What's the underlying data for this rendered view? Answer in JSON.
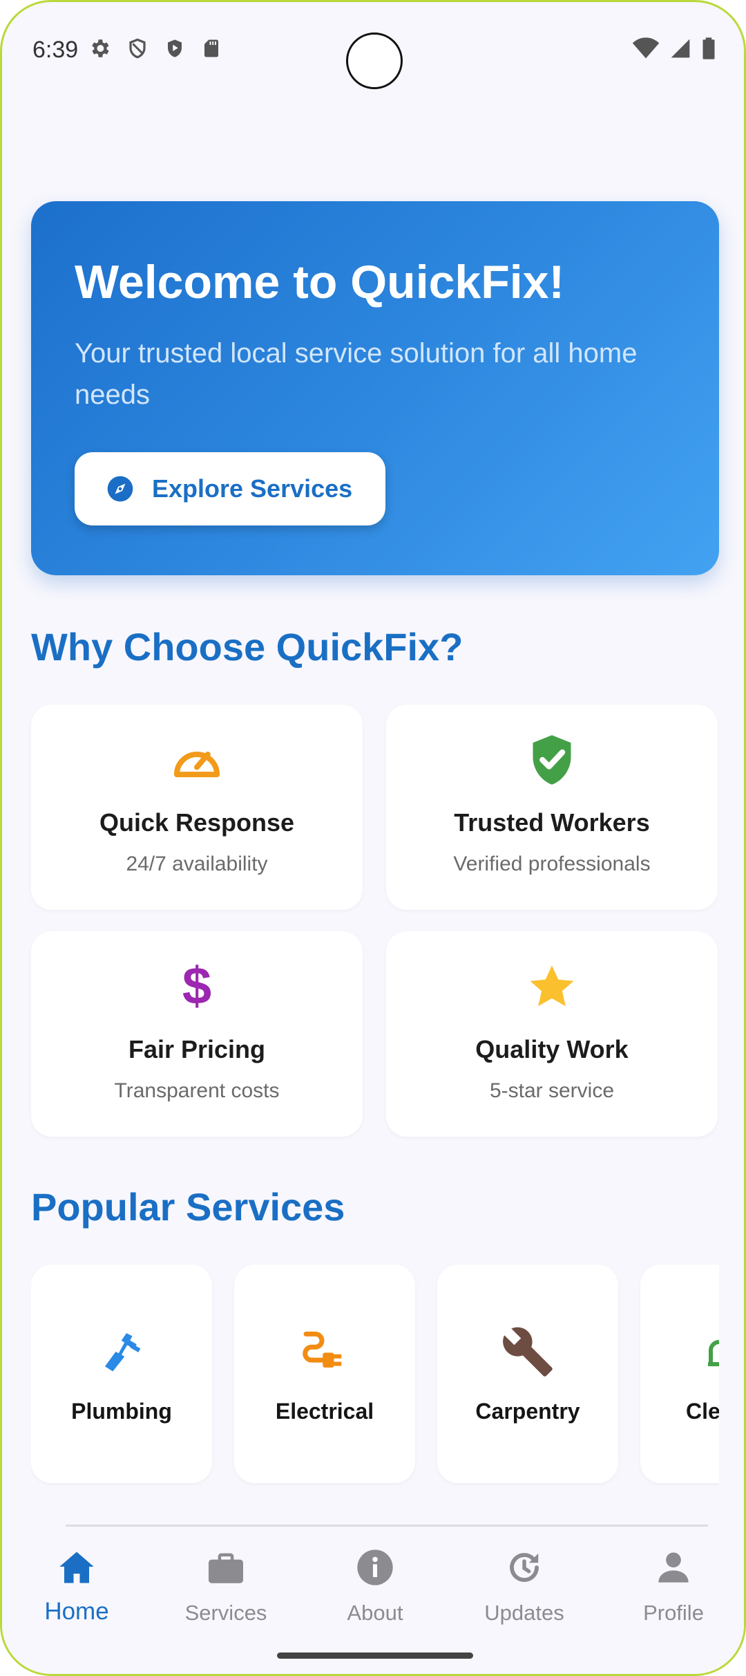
{
  "status_bar": {
    "time": "6:39",
    "left_icons": [
      "gear-icon",
      "shield-outline-icon",
      "shield-play-icon",
      "sd-card-icon"
    ],
    "right_icons": [
      "wifi-icon",
      "signal-icon",
      "battery-icon"
    ]
  },
  "hero": {
    "title": "Welcome to QuickFix!",
    "subtitle": "Your trusted local service solution for all home needs",
    "button_label": "Explore Services",
    "button_icon": "compass-icon",
    "gradient_start": "#1c70cc",
    "gradient_end": "#43a2f2"
  },
  "why_section": {
    "title": "Why Choose QuickFix?",
    "features": [
      {
        "title": "Quick Response",
        "subtitle": "24/7 availability",
        "icon": "speedometer-icon",
        "color": "#f29a1a"
      },
      {
        "title": "Trusted Workers",
        "subtitle": "Verified professionals",
        "icon": "verified-shield-icon",
        "color": "#43a047"
      },
      {
        "title": "Fair Pricing",
        "subtitle": "Transparent costs",
        "icon": "dollar-icon",
        "color": "#9c27b0"
      },
      {
        "title": "Quality Work",
        "subtitle": "5-star service",
        "icon": "star-icon",
        "color": "#fbc02d"
      }
    ]
  },
  "services_section": {
    "title": "Popular Services",
    "services": [
      {
        "label": "Plumbing",
        "icon": "plumbing-icon",
        "color": "#2a8ae6"
      },
      {
        "label": "Electrical",
        "icon": "electrical-plug-icon",
        "color": "#f28c12"
      },
      {
        "label": "Carpentry",
        "icon": "wrench-icon",
        "color": "#6d4c41"
      },
      {
        "label": "Cle",
        "icon": "cleaning-icon",
        "color": "#43a047"
      }
    ]
  },
  "bottom_nav": {
    "items": [
      {
        "label": "Home",
        "icon": "home-icon",
        "active": true
      },
      {
        "label": "Services",
        "icon": "briefcase-icon",
        "active": false
      },
      {
        "label": "About",
        "icon": "info-icon",
        "active": false
      },
      {
        "label": "Updates",
        "icon": "update-icon",
        "active": false
      },
      {
        "label": "Profile",
        "icon": "person-icon",
        "active": false
      }
    ],
    "active_color": "#1a6fc4",
    "inactive_color": "#8b8b90"
  }
}
